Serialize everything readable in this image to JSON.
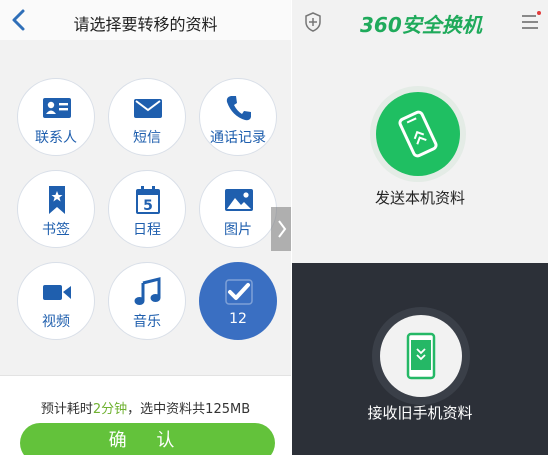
{
  "left": {
    "title": "请选择要转移的资料",
    "categories": [
      {
        "label": "联系人",
        "icon": "contact-card-icon"
      },
      {
        "label": "短信",
        "icon": "envelope-icon"
      },
      {
        "label": "通话记录",
        "icon": "phone-icon"
      },
      {
        "label": "书签",
        "icon": "bookmark-icon"
      },
      {
        "label": "日程",
        "icon": "calendar-icon",
        "icon_text": "5"
      },
      {
        "label": "图片",
        "icon": "image-icon"
      },
      {
        "label": "视频",
        "icon": "video-camera-icon"
      },
      {
        "label": "音乐",
        "icon": "music-note-icon"
      },
      {
        "label": "12",
        "icon": "checkmark-icon",
        "selected": true
      }
    ],
    "estimate": {
      "prefix": "预计耗时",
      "time": "2分钟",
      "middle": "，选中资料共",
      "size": "125MB"
    },
    "confirm_label": "确 认"
  },
  "right": {
    "logo": "360安全换机",
    "send_label": "发送本机资料",
    "receive_label": "接收旧手机资料"
  },
  "colors": {
    "accent_blue": "#1f5fae",
    "selected_blue": "#3a6fc2",
    "green": "#63c23b",
    "brand_green": "#1faa5b",
    "dark_panel": "#2c3038"
  }
}
